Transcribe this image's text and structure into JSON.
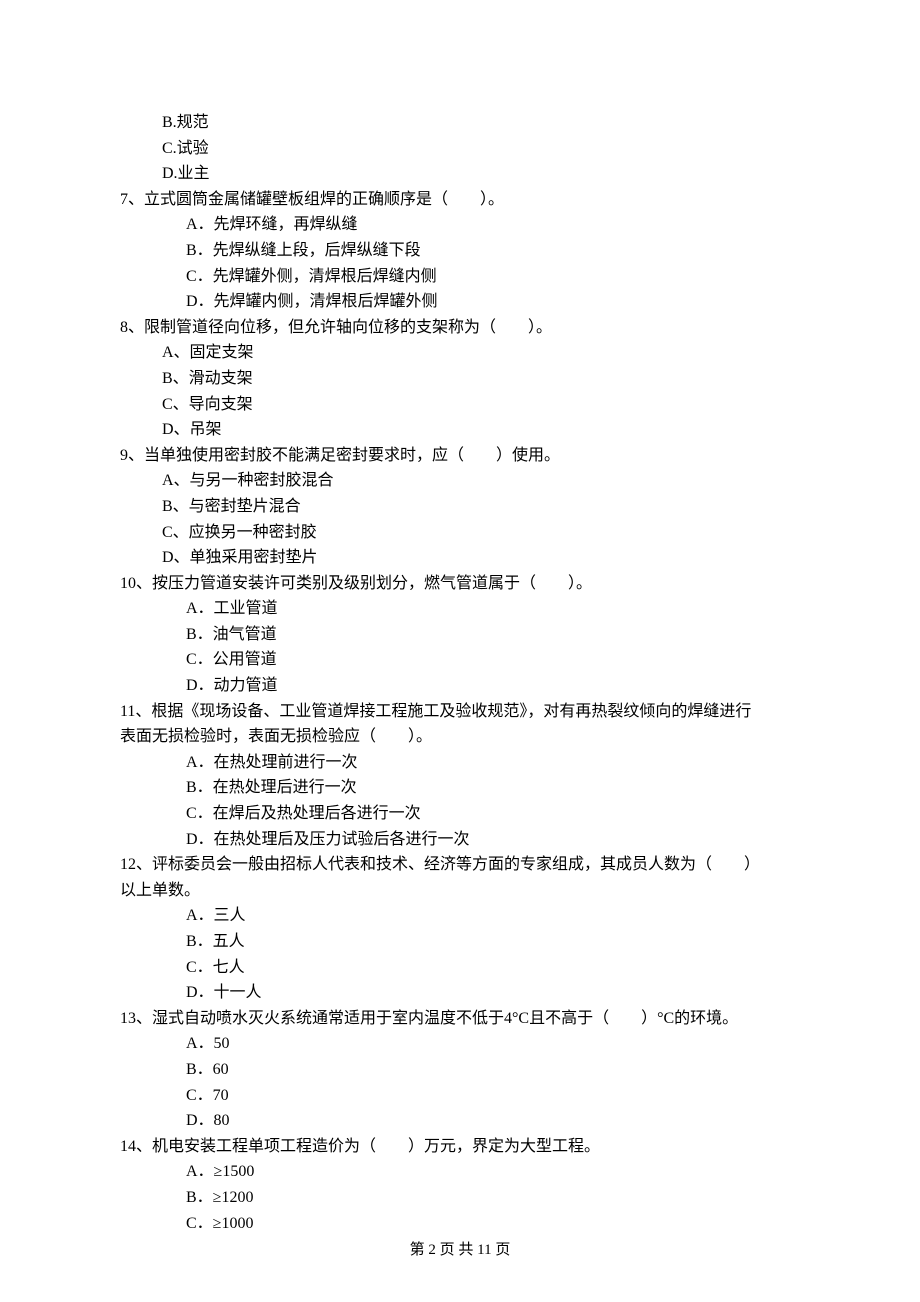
{
  "orphan_options": {
    "b": "B.规范",
    "c": "C.试验",
    "d": "D.业主"
  },
  "q7": {
    "stem": "7、立式圆筒金属储罐壁板组焊的正确顺序是（　　）。",
    "a": "A．先焊环缝，再焊纵缝",
    "b": "B．先焊纵缝上段，后焊纵缝下段",
    "c": "C．先焊罐外侧，清焊根后焊缝内侧",
    "d": "D．先焊罐内侧，清焊根后焊罐外侧"
  },
  "q8": {
    "stem": "8、限制管道径向位移，但允许轴向位移的支架称为（　　）。",
    "a": "A、固定支架",
    "b": "B、滑动支架",
    "c": "C、导向支架",
    "d": "D、吊架"
  },
  "q9": {
    "stem": "9、当单独使用密封胶不能满足密封要求时，应（　　）使用。",
    "a": "A、与另一种密封胶混合",
    "b": "B、与密封垫片混合",
    "c": "C、应换另一种密封胶",
    "d": "D、单独采用密封垫片"
  },
  "q10": {
    "stem": "10、按压力管道安装许可类别及级别划分，燃气管道属于（　　）。",
    "a": "A．工业管道",
    "b": "B．油气管道",
    "c": "C．公用管道",
    "d": "D．动力管道"
  },
  "q11": {
    "stem_line1": "11、根据《现场设备、工业管道焊接工程施工及验收规范》，对有再热裂纹倾向的焊缝进行",
    "stem_line2": "表面无损检验时，表面无损检验应（　　）。",
    "a": "A．在热处理前进行一次",
    "b": "B．在热处理后进行一次",
    "c": "C．在焊后及热处理后各进行一次",
    "d": "D．在热处理后及压力试验后各进行一次"
  },
  "q12": {
    "stem_line1": "12、评标委员会一般由招标人代表和技术、经济等方面的专家组成，其成员人数为（　　）",
    "stem_line2": "以上单数。",
    "a": "A．三人",
    "b": "B．五人",
    "c": "C．七人",
    "d": "D．十一人"
  },
  "q13": {
    "stem": "13、湿式自动喷水灭火系统通常适用于室内温度不低于4°C且不高于（　　）°C的环境。",
    "a": "A．50",
    "b": "B．60",
    "c": "C．70",
    "d": "D．80"
  },
  "q14": {
    "stem": "14、机电安装工程单项工程造价为（　　）万元，界定为大型工程。",
    "a": "A．≥1500",
    "b": "B．≥1200",
    "c": "C．≥1000"
  },
  "footer": "第 2 页 共 11 页"
}
